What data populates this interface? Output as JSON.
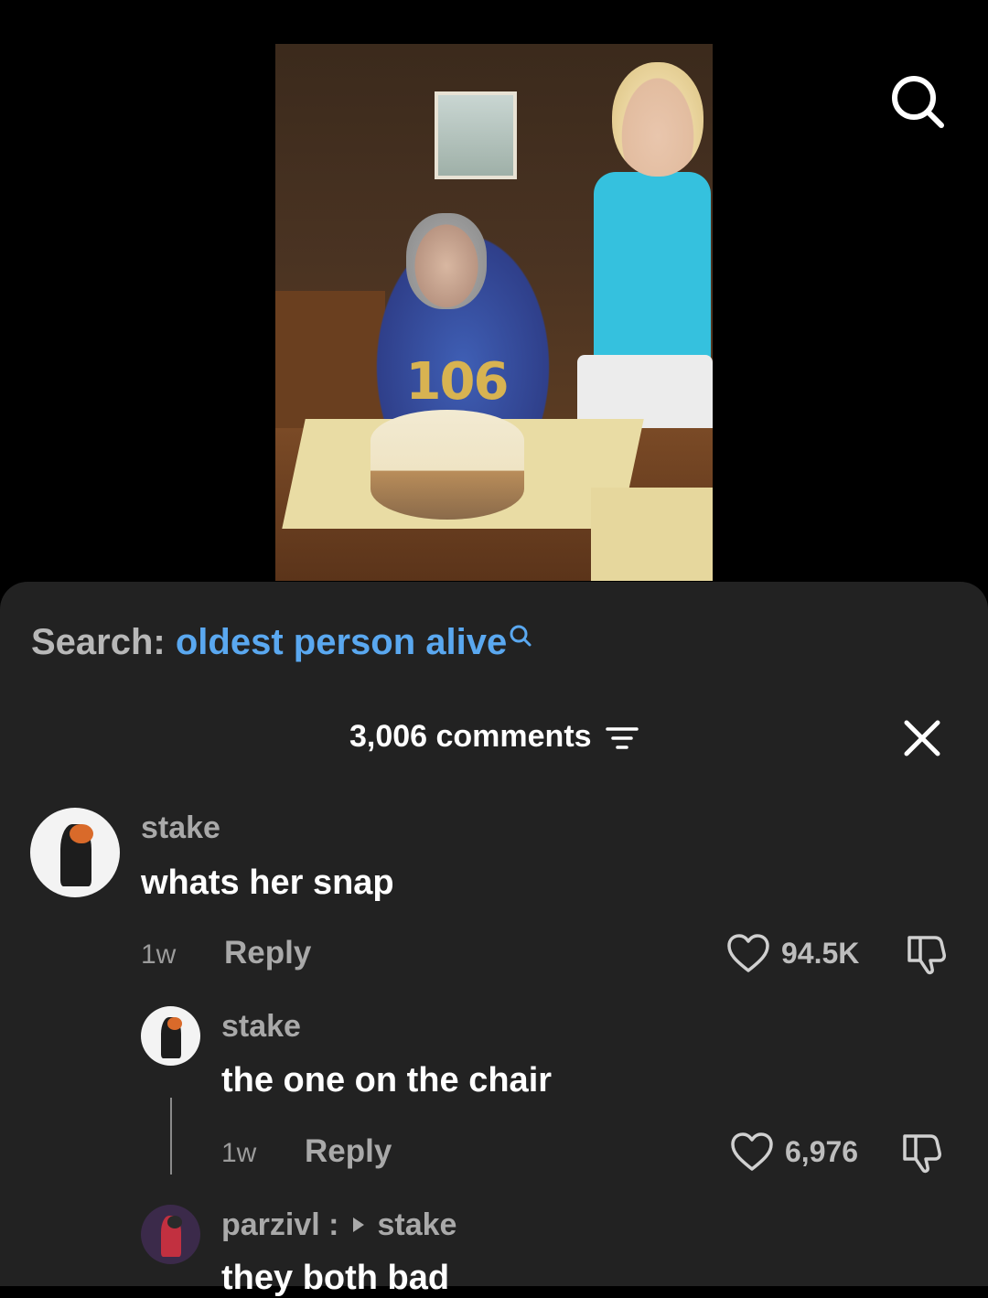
{
  "search": {
    "prefix": "Search:",
    "query": "oldest person alive"
  },
  "header": {
    "count_label": "3,006 comments"
  },
  "video": {
    "candle_text": "106"
  },
  "comments": [
    {
      "user": "stake",
      "text": "whats her snap",
      "time": "1w",
      "reply_label": "Reply",
      "likes": "94.5K"
    },
    {
      "user": "stake",
      "text": "the one on the chair",
      "time": "1w",
      "reply_label": "Reply",
      "likes": "6,976"
    },
    {
      "user": "parzivl :",
      "reply_to": "stake",
      "text": "they both bad"
    }
  ],
  "colors": {
    "sheet_bg": "#222222",
    "accent_link": "#5aa8f0",
    "muted": "#a9a9a9"
  }
}
